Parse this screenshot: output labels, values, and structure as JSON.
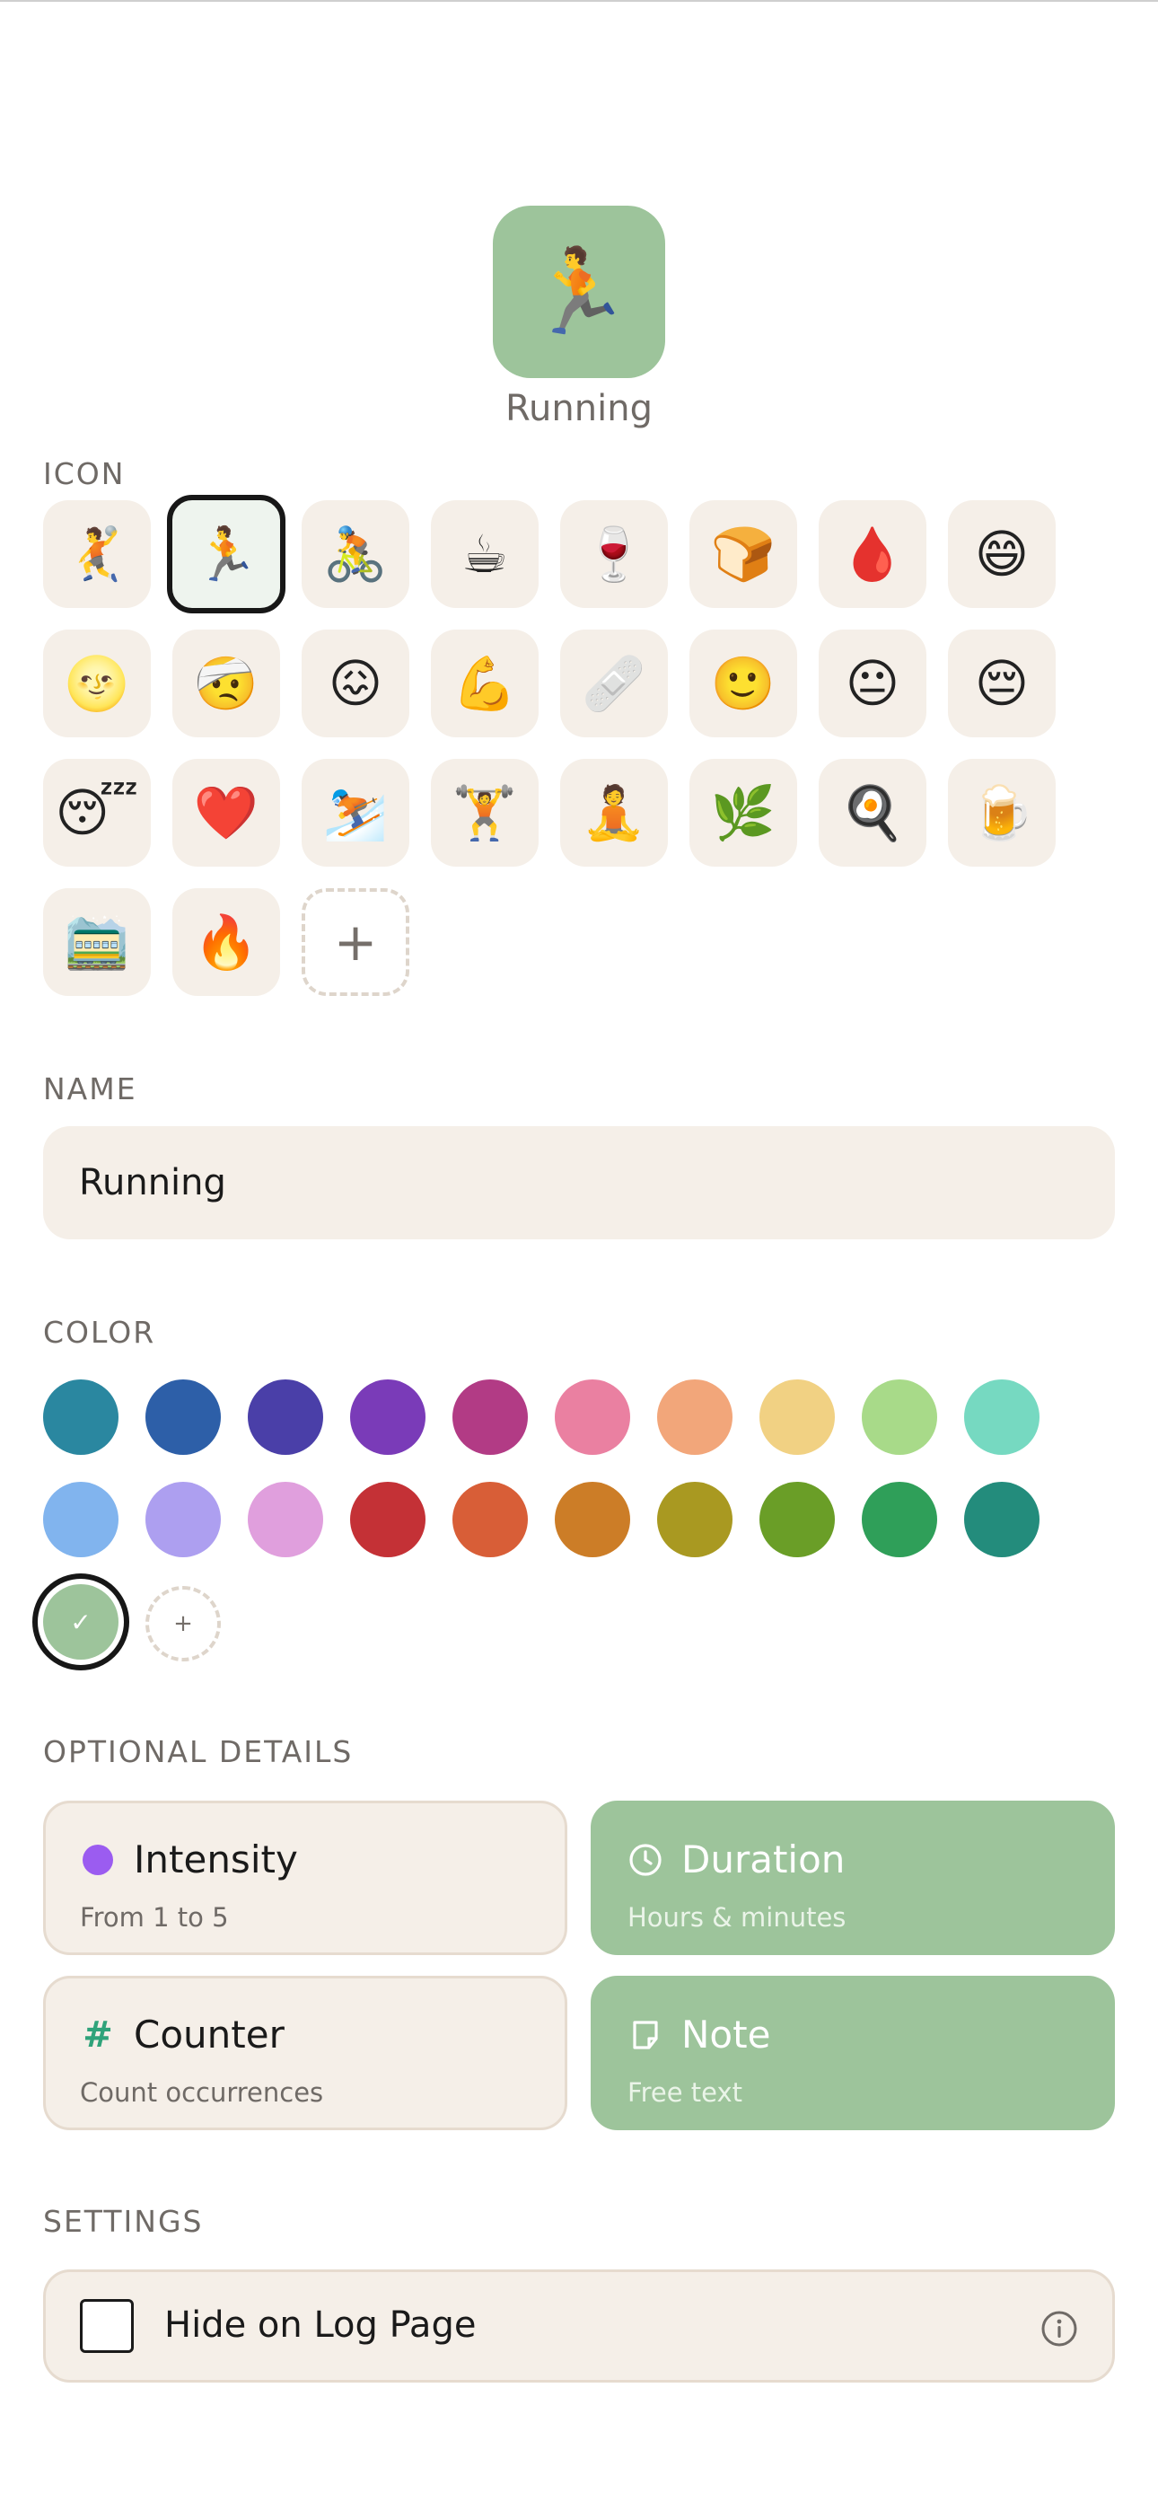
{
  "preview": {
    "icon": "🏃",
    "name": "Running",
    "color": "#9dc49b"
  },
  "icon_section": {
    "label": "ICON",
    "icons": [
      "🤾",
      "🏃",
      "🚴",
      "☕",
      "🍷",
      "🍞",
      "🩸",
      "😄",
      "🌝",
      "🤕",
      "😖",
      "💪",
      "🩹",
      "🙂",
      "😐",
      "😔",
      "😴",
      "❤️",
      "⛷️",
      "🏋️",
      "🧘",
      "🌿",
      "🍳",
      "🍺",
      "🚞",
      "🔥"
    ],
    "selected_index": 1,
    "add_symbol": "+"
  },
  "name_section": {
    "label": "NAME",
    "value": "Running"
  },
  "color_section": {
    "label": "COLOR",
    "colors": [
      "#2a87a0",
      "#2d5fa8",
      "#4a3fa8",
      "#7a3bb8",
      "#b23b85",
      "#ea80a1",
      "#f2a67a",
      "#f1d183",
      "#a8da89",
      "#76d9c1",
      "#81b4ee",
      "#ad9ff0",
      "#e09fdd",
      "#c43136",
      "#d85e37",
      "#cc7d27",
      "#a99921",
      "#6a9e27",
      "#2f9f59",
      "#238c7c"
    ],
    "selected_color": "#9dc49b",
    "selected_mark": "✓",
    "add_symbol": "+"
  },
  "optional_details": {
    "label": "OPTIONAL DETAILS",
    "items": [
      {
        "title": "Intensity",
        "subtitle": "From 1 to 5",
        "enabled": false,
        "icon": "purple-dot-icon",
        "icon_color": "#9b5cf0"
      },
      {
        "title": "Duration",
        "subtitle": "Hours & minutes",
        "enabled": true,
        "icon": "clock-icon"
      },
      {
        "title": "Counter",
        "subtitle": "Count occurrences",
        "enabled": false,
        "icon": "hash-icon",
        "icon_text": "#"
      },
      {
        "title": "Note",
        "subtitle": "Free text",
        "enabled": true,
        "icon": "note-icon"
      }
    ]
  },
  "settings": {
    "label": "SETTINGS",
    "hide_on_log_page": {
      "label": "Hide on Log Page",
      "checked": false
    }
  }
}
